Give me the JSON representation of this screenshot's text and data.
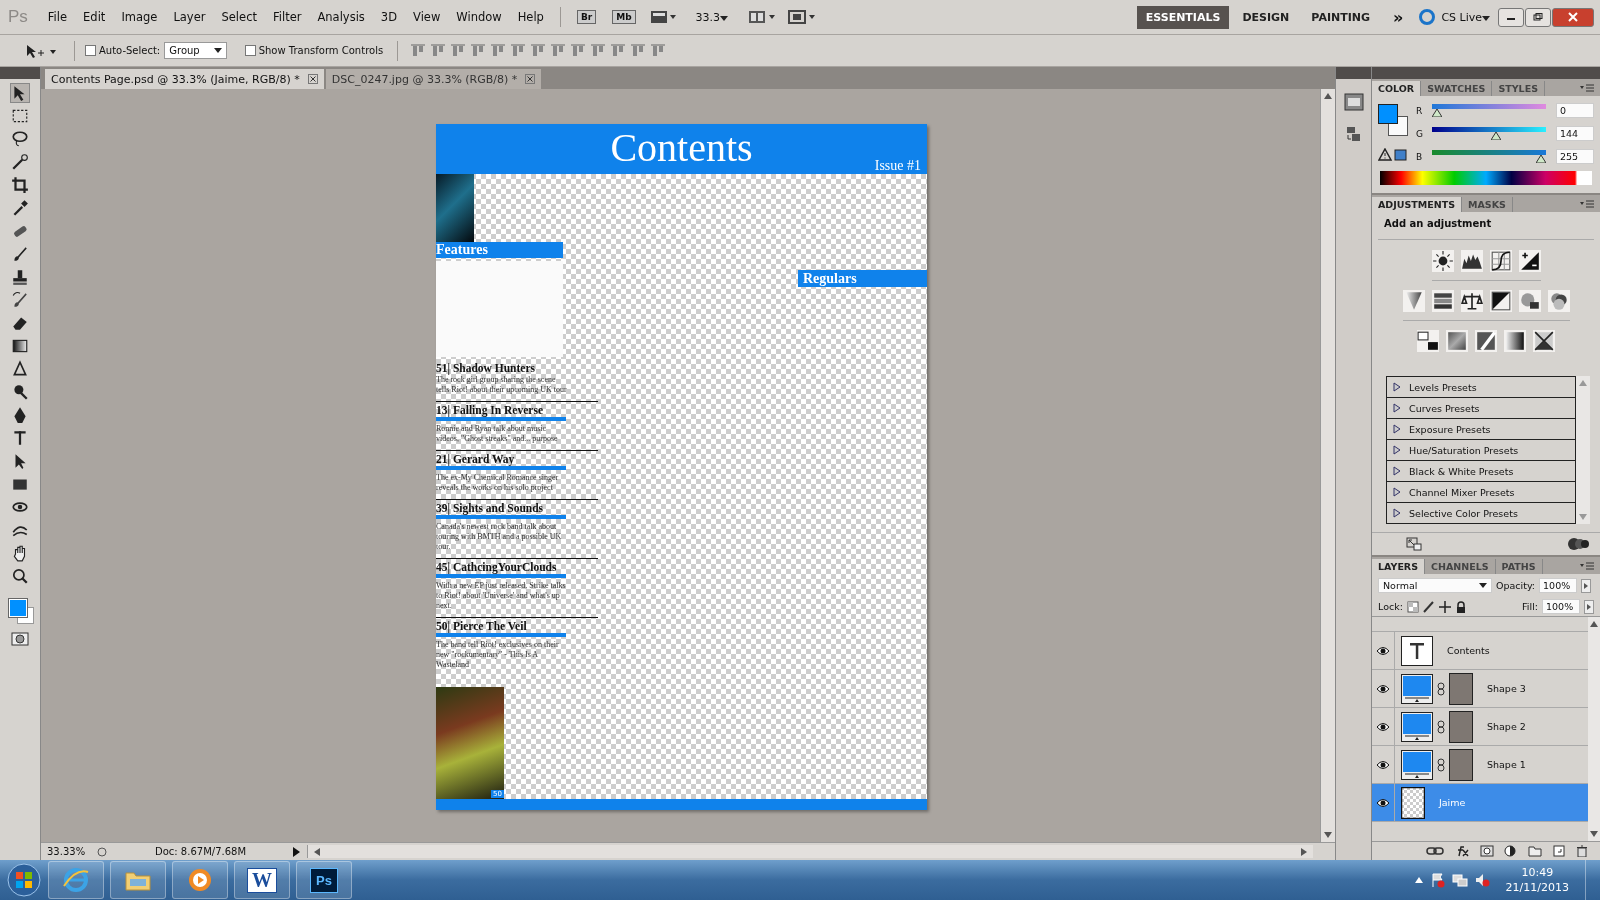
{
  "menu_bar": {
    "logo": "Ps",
    "menus": [
      "File",
      "Edit",
      "Image",
      "Layer",
      "Select",
      "Filter",
      "Analysis",
      "3D",
      "View",
      "Window",
      "Help"
    ],
    "bridge": "Br",
    "mini_bridge": "Mb",
    "zoom": "33.3",
    "workspaces": [
      {
        "label": "ESSENTIALS",
        "selected": true
      },
      {
        "label": "DESIGN",
        "selected": false
      },
      {
        "label": "PAINTING",
        "selected": false
      }
    ],
    "more": "»",
    "cs_live": "CS Live"
  },
  "options_bar": {
    "auto_select": {
      "label": "Auto-Select:",
      "checked": false
    },
    "auto_select_target": "Group",
    "transform_controls": {
      "label": "Show Transform Controls",
      "checked": false
    }
  },
  "doc_tabs": [
    {
      "label": "Contents Page.psd @ 33.3% (Jaime, RGB/8) *",
      "selected": true
    },
    {
      "label": "DSC_0247.jpg @ 33.3% (RGB/8) *",
      "selected": false
    }
  ],
  "document": {
    "title": "Contents",
    "issue": "Issue #1",
    "features_heading": "Features",
    "regulars_heading": "Regulars",
    "articles": [
      {
        "title": "51| Shadow Hunters",
        "underlined": false,
        "description": "The rock girl group sharing the scene tells Riot! about their upcoming UK tour"
      },
      {
        "title": "13| Falling In Reverse",
        "underlined": true,
        "description": "Ronnie and Ryan talk about music videos, \"Ghost streaks\" and... purpose"
      },
      {
        "title": "21| Gerard Way",
        "underlined": true,
        "description": "The ex-My Chemical Romance singer reveals the works on his solo project"
      },
      {
        "title": "39| Sights and Sounds",
        "underlined": true,
        "description": "Canada's newest rock band talk about touring with BMTH and a possible UK tour."
      },
      {
        "title": "45| CathcingYourClouds",
        "underlined": true,
        "description": "With a new EP just released, Strike talks to Riot! about 'Universe' and what's up next."
      },
      {
        "title": "50| Pierce The Veil",
        "underlined": true,
        "description": "The band tell Riot! exclusives on their new \"rockumentary\" - This Is A Wasteland"
      }
    ],
    "photo_badge": "50"
  },
  "status_bar": {
    "zoom": "33.33%",
    "doc_size": "Doc: 8.67M/7.68M"
  },
  "color_panel": {
    "tabs": [
      {
        "label": "COLOR",
        "selected": true
      },
      {
        "label": "SWATCHES",
        "selected": false
      },
      {
        "label": "STYLES",
        "selected": false
      }
    ],
    "channels": [
      {
        "name": "R",
        "value": "0",
        "level": 0
      },
      {
        "name": "G",
        "value": "144",
        "level": 0.565
      },
      {
        "name": "B",
        "value": "255",
        "level": 1
      }
    ]
  },
  "adjustments_panel": {
    "tabs": [
      {
        "label": "ADJUSTMENTS",
        "selected": true
      },
      {
        "label": "MASKS",
        "selected": false
      }
    ],
    "heading": "Add an adjustment",
    "presets": [
      "Levels Presets",
      "Curves Presets",
      "Exposure Presets",
      "Hue/Saturation Presets",
      "Black & White Presets",
      "Channel Mixer Presets",
      "Selective Color Presets"
    ]
  },
  "layers_panel": {
    "tabs": [
      {
        "label": "LAYERS",
        "selected": true
      },
      {
        "label": "CHANNELS",
        "selected": false
      },
      {
        "label": "PATHS",
        "selected": false
      }
    ],
    "blend_mode": "Normal",
    "opacity_label": "Opacity:",
    "opacity": "100%",
    "lock_label": "Lock:",
    "fill_label": "Fill:",
    "fill": "100%",
    "layers": [
      {
        "name": "Contents",
        "kind": "text",
        "visible": true,
        "selected": false
      },
      {
        "name": "Shape 3",
        "kind": "shape",
        "visible": true,
        "selected": false
      },
      {
        "name": "Shape 2",
        "kind": "shape",
        "visible": true,
        "selected": false
      },
      {
        "name": "Shape 1",
        "kind": "shape",
        "visible": true,
        "selected": false
      },
      {
        "name": "Jaime",
        "kind": "pixel",
        "visible": true,
        "selected": true
      }
    ]
  },
  "taskbar": {
    "apps": [
      {
        "kind": "browser"
      },
      {
        "kind": "folder"
      },
      {
        "kind": "media"
      },
      {
        "kind": "word",
        "label": "W"
      },
      {
        "kind": "photoshop",
        "label": "Ps"
      }
    ],
    "time": "10:49",
    "date": "21/11/2013"
  }
}
